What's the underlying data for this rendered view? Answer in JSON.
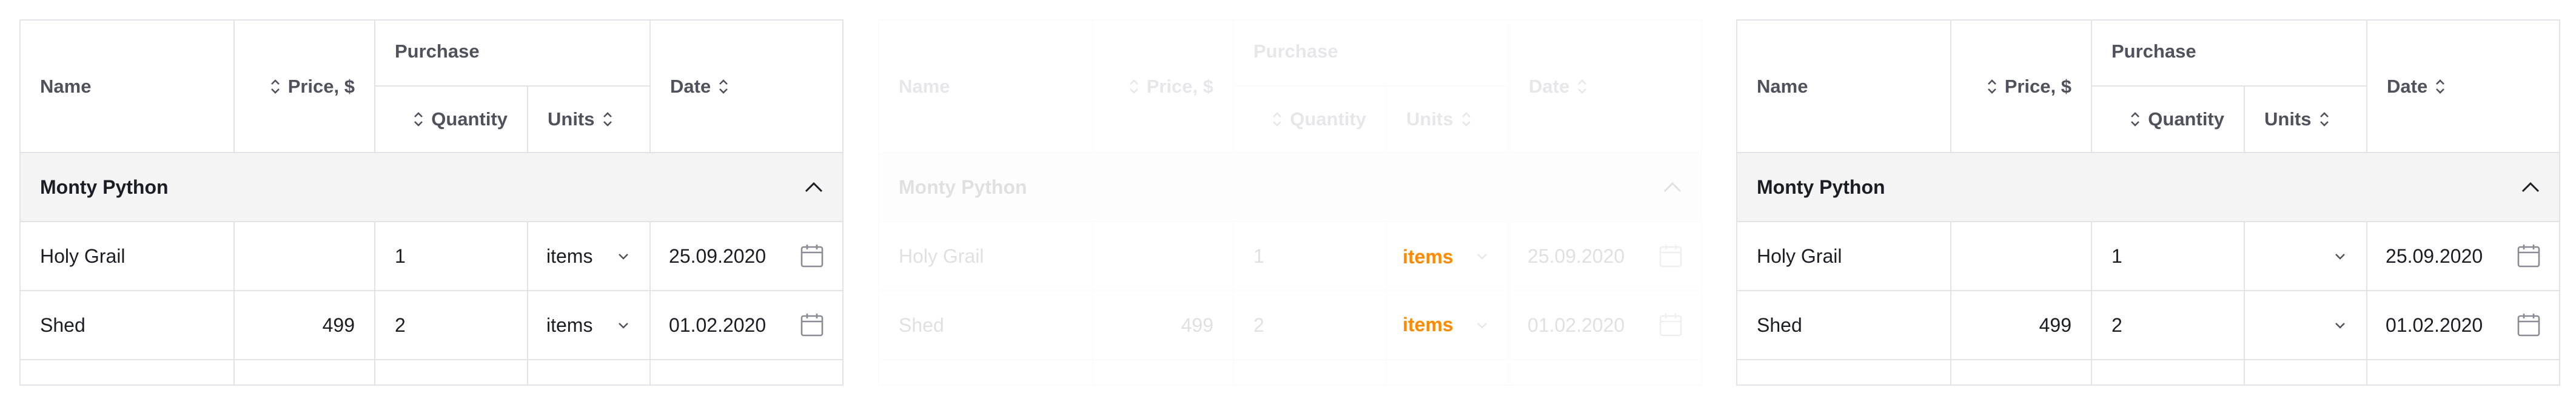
{
  "columns": {
    "name": "Name",
    "price": "Price, $",
    "purchase": "Purchase",
    "quantity": "Quantity",
    "units": "Units",
    "date": "Date"
  },
  "group": {
    "title": "Monty Python"
  },
  "rows": [
    {
      "name": "Holy Grail",
      "price": "",
      "quantity": "1",
      "units": "items",
      "date": "25.09.2020"
    },
    {
      "name": "Shed",
      "price": "499",
      "quantity": "2",
      "units": "items",
      "date": "01.02.2020"
    }
  ],
  "colors": {
    "border": "#e3e3e7",
    "group_bg": "#f4f4f5",
    "header_text": "#51515d",
    "highlight_units": "#ff8a00"
  },
  "panels": [
    {
      "variant": "normal"
    },
    {
      "variant": "faded"
    },
    {
      "variant": "units-empty"
    }
  ]
}
